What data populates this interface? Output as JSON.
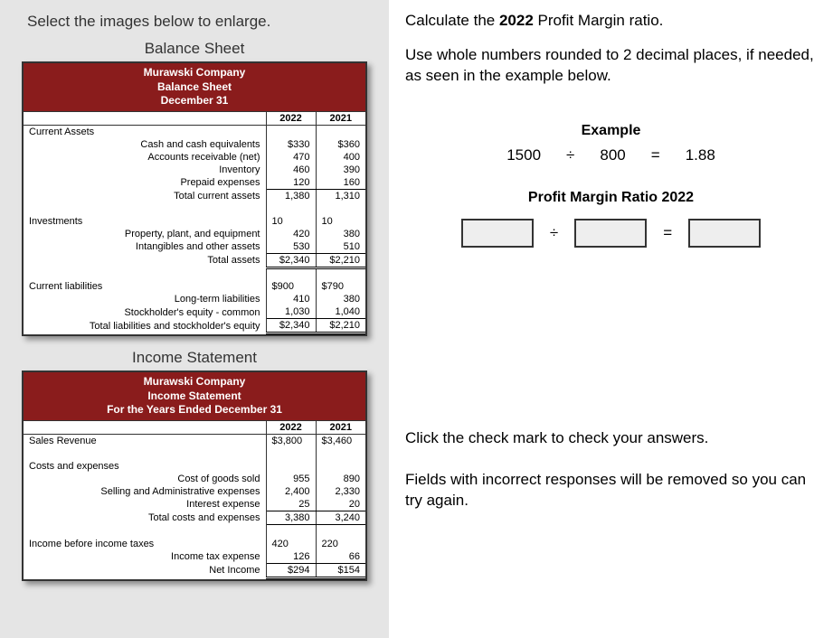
{
  "left": {
    "instruction": "Select the images below to enlarge.",
    "balance_sheet_title": "Balance Sheet",
    "income_statement_title": "Income Statement",
    "bs_header_line1": "Murawski Company",
    "bs_header_line2": "Balance Sheet",
    "bs_header_line3": "December 31",
    "is_header_line1": "Murawski Company",
    "is_header_line2": "Income Statement",
    "is_header_line3": "For the Years Ended December 31",
    "year_2022": "2022",
    "year_2021": "2021",
    "bs_sections": {
      "current_assets_label": "Current Assets",
      "cash_label": "Cash and cash equivalents",
      "cash_2022": "$330",
      "cash_2021": "$360",
      "ar_label": "Accounts receivable (net)",
      "ar_2022": "470",
      "ar_2021": "400",
      "inv_label": "Inventory",
      "inv_2022": "460",
      "inv_2021": "390",
      "prepaid_label": "Prepaid expenses",
      "prepaid_2022": "120",
      "prepaid_2021": "160",
      "tca_label": "Total current assets",
      "tca_2022": "1,380",
      "tca_2021": "1,310",
      "investments_label": "Investments",
      "inv2_2022": "10",
      "inv2_2021": "10",
      "ppe_label": "Property, plant, and equipment",
      "ppe_2022": "420",
      "ppe_2021": "380",
      "intang_label": "Intangibles and other assets",
      "intang_2022": "530",
      "intang_2021": "510",
      "ta_label": "Total assets",
      "ta_2022": "$2,340",
      "ta_2021": "$2,210",
      "cl_label": "Current liabilities",
      "cl_2022": "$900",
      "cl_2021": "$790",
      "ltl_label": "Long-term liabilities",
      "ltl_2022": "410",
      "ltl_2021": "380",
      "se_label": "Stockholder's equity - common",
      "se_2022": "1,030",
      "se_2021": "1,040",
      "tlse_label": "Total liabilities and stockholder's equity",
      "tlse_2022": "$2,340",
      "tlse_2021": "$2,210"
    },
    "is_sections": {
      "sales_label": "Sales Revenue",
      "sales_2022": "$3,800",
      "sales_2021": "$3,460",
      "costs_header": "Costs and expenses",
      "cogs_label": "Cost of goods sold",
      "cogs_2022": "955",
      "cogs_2021": "890",
      "sga_label": "Selling and Administrative expenses",
      "sga_2022": "2,400",
      "sga_2021": "2,330",
      "int_label": "Interest expense",
      "int_2022": "25",
      "int_2021": "20",
      "tce_label": "Total costs and expenses",
      "tce_2022": "3,380",
      "tce_2021": "3,240",
      "ibt_label": "Income before income taxes",
      "ibt_2022": "420",
      "ibt_2021": "220",
      "ite_label": "Income tax expense",
      "ite_2022": "126",
      "ite_2021": "66",
      "ni_label": "Net Income",
      "ni_2022": "$294",
      "ni_2021": "$154"
    }
  },
  "right": {
    "q_prefix": "Calculate the ",
    "q_bold": "2022",
    "q_suffix": " Profit Margin ratio.",
    "sub_instr": "Use whole numbers rounded to 2 decimal places, if needed, as seen in the example below.",
    "example_label": "Example",
    "example_num": "1500",
    "example_div": "÷",
    "example_den": "800",
    "example_eq": "=",
    "example_res": "1.88",
    "ratio_title": "Profit Margin Ratio 2022",
    "div_sym": "÷",
    "eq_sym": "=",
    "check_text": "Click the check mark to check your answers.",
    "retry_text": "Fields with incorrect responses will be removed so you can try again."
  }
}
